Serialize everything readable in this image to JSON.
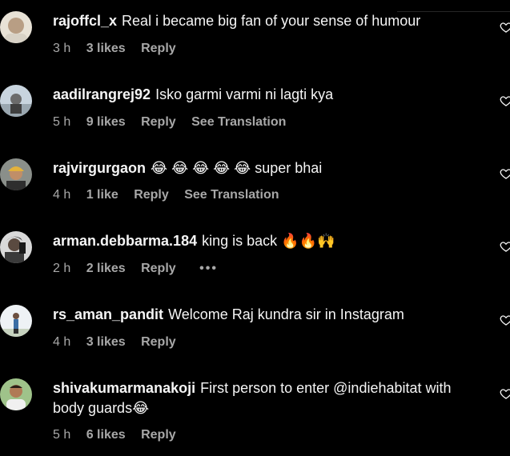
{
  "comments": [
    {
      "username": "rajoffcl_x",
      "text": "Real i became big fan of your sense of humour",
      "time": "3 h",
      "likes": "3 likes",
      "reply": "Reply",
      "avatar_color": "#c9b99a"
    },
    {
      "username": "aadilrangrej92",
      "text": "Isko garmi varmi ni lagti kya",
      "time": "5 h",
      "likes": "9 likes",
      "reply": "Reply",
      "translate": "See Translation",
      "avatar_color": "#8ea3b0"
    },
    {
      "username": "rajvirgurgaon",
      "text": "😂 😂 😂 😂 😂  super bhai",
      "time": "4 h",
      "likes": "1 like",
      "reply": "Reply",
      "translate": "See Translation",
      "avatar_color": "#6d5a3a"
    },
    {
      "username": "arman.debbarma.184",
      "text": "king is back 🔥🔥🙌",
      "time": "2 h",
      "likes": "2 likes",
      "reply": "Reply",
      "more": "•••",
      "avatar_color": "#bfbfbf"
    },
    {
      "username": "rs_aman_pandit",
      "text": "Welcome Raj kundra sir in Instagram",
      "time": "4 h",
      "likes": "3 likes",
      "reply": "Reply",
      "avatar_color": "#d4dde6"
    },
    {
      "username": "shivakumarmanakoji",
      "text": "First person to enter @indiehabitat with body guards😂",
      "time": "5 h",
      "likes": "6 likes",
      "reply": "Reply",
      "avatar_color": "#7fa06a"
    }
  ],
  "icons": {
    "like": "heart-outline-icon",
    "more": "more-options-icon"
  }
}
